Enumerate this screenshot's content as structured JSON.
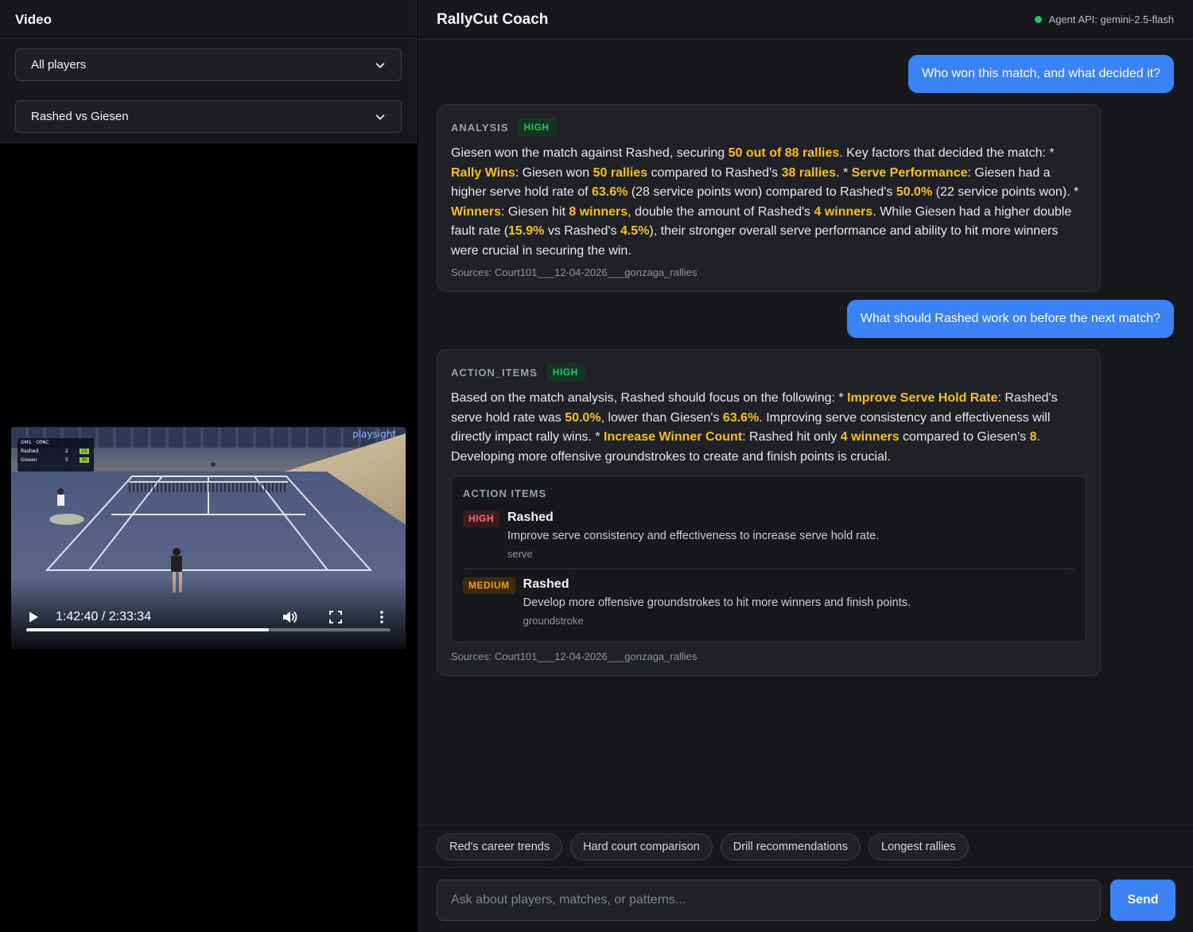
{
  "left": {
    "title": "Video",
    "player_filter": "All players",
    "match_select": "Rashed vs Giesen",
    "video": {
      "time": "1:42:40 / 2:33:34",
      "progress_fraction": 0.667,
      "logo": "playsight",
      "scoreboard": {
        "header": "GM1 · OPAC",
        "rows": [
          {
            "name": "Rashed",
            "games": "2",
            "points": "15"
          },
          {
            "name": "Giesen",
            "games": "5",
            "points": "30"
          }
        ]
      }
    }
  },
  "header": {
    "title": "RallyCut Coach",
    "status": "Agent API: gemini-2.5-flash"
  },
  "messages": {
    "q1": "Who won this match, and what decided it?",
    "a1": {
      "kind": "ANALYSIS",
      "confidence": "HIGH",
      "parts": [
        [
          "Giesen won the match against Rashed, securing ",
          false
        ],
        [
          "50 out of 88 rallies",
          true
        ],
        [
          ". Key factors that decided the match: * ",
          false
        ],
        [
          "Rally Wins",
          true
        ],
        [
          ": Giesen won ",
          false
        ],
        [
          "50 rallies",
          true
        ],
        [
          " compared to Rashed's ",
          false
        ],
        [
          "38 rallies",
          true
        ],
        [
          ". * ",
          false
        ],
        [
          "Serve Performance",
          true
        ],
        [
          ": Giesen had a higher serve hold rate of ",
          false
        ],
        [
          "63.6%",
          true
        ],
        [
          " (28 service points won) compared to Rashed's ",
          false
        ],
        [
          "50.0%",
          true
        ],
        [
          " (22 service points won). * ",
          false
        ],
        [
          "Winners",
          true
        ],
        [
          ": Giesen hit ",
          false
        ],
        [
          "8 winners",
          true
        ],
        [
          ", double the amount of Rashed's ",
          false
        ],
        [
          "4 winners",
          true
        ],
        [
          ". While Giesen had a higher double fault rate (",
          false
        ],
        [
          "15.9%",
          true
        ],
        [
          " vs Rashed's ",
          false
        ],
        [
          "4.5%",
          true
        ],
        [
          "), their stronger overall serve performance and ability to hit more winners were crucial in securing the win.",
          false
        ]
      ],
      "sources": "Sources: Court101___12-04-2026___gonzaga_rallies"
    },
    "q2": "What should Rashed work on before the next match?",
    "a2": {
      "kind": "ACTION_ITEMS",
      "confidence": "HIGH",
      "parts": [
        [
          "Based on the match analysis, Rashed should focus on the following: * ",
          false
        ],
        [
          "Improve Serve Hold Rate",
          true
        ],
        [
          ": Rashed's serve hold rate was ",
          false
        ],
        [
          "50.0%",
          true
        ],
        [
          ", lower than Giesen's ",
          false
        ],
        [
          "63.6%",
          true
        ],
        [
          ". Improving serve consistency and effectiveness will directly impact rally wins. * ",
          false
        ],
        [
          "Increase Winner Count",
          true
        ],
        [
          ": Rashed hit only ",
          false
        ],
        [
          "4 winners",
          true
        ],
        [
          " compared to Giesen's ",
          false
        ],
        [
          "8",
          true
        ],
        [
          ". Developing more offensive groundstrokes to create and finish points is crucial.",
          false
        ]
      ],
      "action_items_title": "ACTION ITEMS",
      "items": [
        {
          "priority": "HIGH",
          "player": "Rashed",
          "desc": "Improve serve consistency and effectiveness to increase serve hold rate.",
          "tag": "serve"
        },
        {
          "priority": "MEDIUM",
          "player": "Rashed",
          "desc": "Develop more offensive groundstrokes to hit more winners and finish points.",
          "tag": "groundstroke"
        }
      ],
      "sources": "Sources: Court101___12-04-2026___gonzaga_rallies"
    }
  },
  "chips": [
    "Red's career trends",
    "Hard court comparison",
    "Drill recommendations",
    "Longest rallies"
  ],
  "input": {
    "placeholder": "Ask about players, matches, or patterns...",
    "send_label": "Send"
  },
  "colors": {
    "accent": "#3b82f6",
    "highlight": "#fbbf24",
    "high": "#22c55e",
    "priority_high": "#f87171",
    "priority_medium": "#f59e0b"
  }
}
